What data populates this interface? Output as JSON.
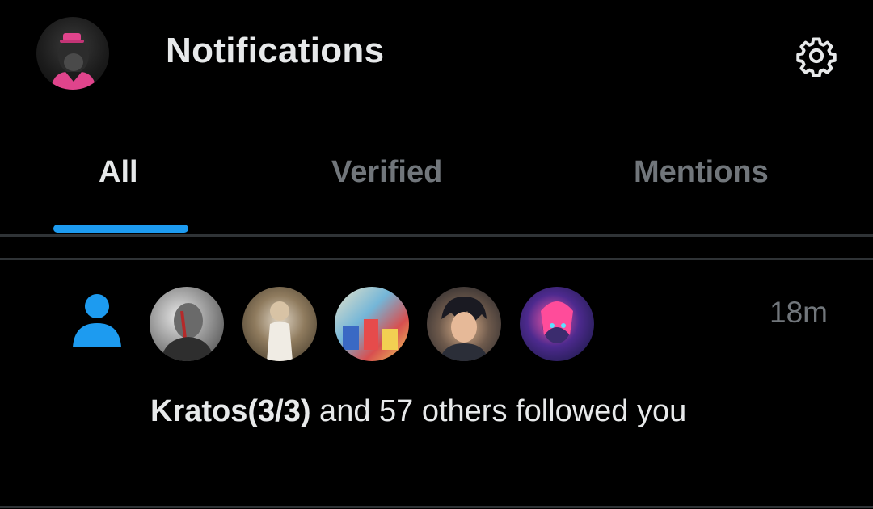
{
  "header": {
    "title": "Notifications",
    "profile_avatar_icon": "profile-avatar-ape",
    "settings_icon": "gear-icon"
  },
  "tabs": [
    {
      "label": "All",
      "active": true
    },
    {
      "label": "Verified",
      "active": false
    },
    {
      "label": "Mentions",
      "active": false
    }
  ],
  "notification": {
    "icon": "person-icon",
    "follower_count_avatars": 5,
    "timestamp": "18m",
    "actor": "Kratos(3/3)",
    "message": " and 57 others followed you"
  },
  "colors": {
    "background": "#000000",
    "text": "#e7e9ea",
    "muted": "#71767b",
    "accent": "#1d9bf0",
    "divider": "#2f3336"
  }
}
